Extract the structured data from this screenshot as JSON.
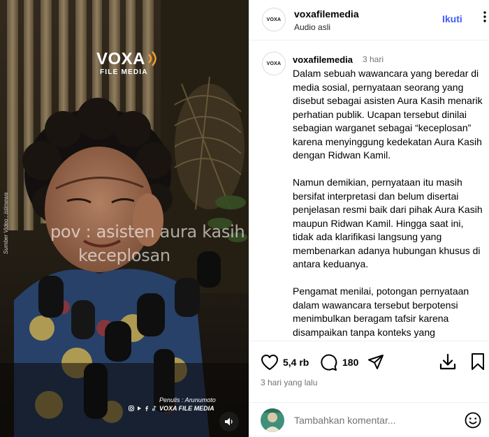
{
  "video": {
    "logo_name": "VOXA",
    "logo_sub": "FILE MEDIA",
    "caption_line1": "pov : asisten aura kasih",
    "caption_line2": "keceplosan",
    "source": "Sumber Video : istimewa",
    "writer": "Penulis : Arunumoto",
    "footer_brand": "VOXA FILE MEDIA",
    "audio_icon": "speaker-icon"
  },
  "header": {
    "username": "voxafilemedia",
    "subtitle": "Audio asli",
    "follow_label": "Ikuti",
    "avatar_text": "VOXA",
    "more_icon": "more-vertical-icon"
  },
  "caption": {
    "username": "voxafilemedia",
    "time": "3 hari",
    "paragraphs": [
      "Dalam sebuah wawancara yang beredar di media sosial, pernyataan seorang yang disebut sebagai asisten Aura Kasih menarik perhatian publik. Ucapan tersebut dinilai sebagian warganet sebagai “keceplosan” karena menyinggung kedekatan Aura Kasih dengan Ridwan Kamil.",
      "Namun demikian, pernyataan itu masih bersifat interpretasi dan belum disertai penjelasan resmi baik dari pihak Aura Kasih maupun Ridwan Kamil. Hingga saat ini, tidak ada klarifikasi langsung yang membenarkan adanya hubungan khusus di antara keduanya.",
      "Pengamat menilai, potongan pernyataan dalam wawancara tersebut berpotensi menimbulkan beragam tafsir karena disampaikan tanpa konteks yang"
    ]
  },
  "actions": {
    "like_count": "5,4 rb",
    "comment_count": "180",
    "date": "3 hari yang lalu",
    "icons": [
      "heart-icon",
      "comment-icon",
      "share-icon",
      "download-icon",
      "bookmark-icon"
    ]
  },
  "add_comment": {
    "placeholder": "Tambahkan komentar...",
    "emoji_icon": "emoji-icon"
  },
  "colors": {
    "accent": "#3d5cf5",
    "muted": "#737373",
    "border": "#efefef"
  }
}
